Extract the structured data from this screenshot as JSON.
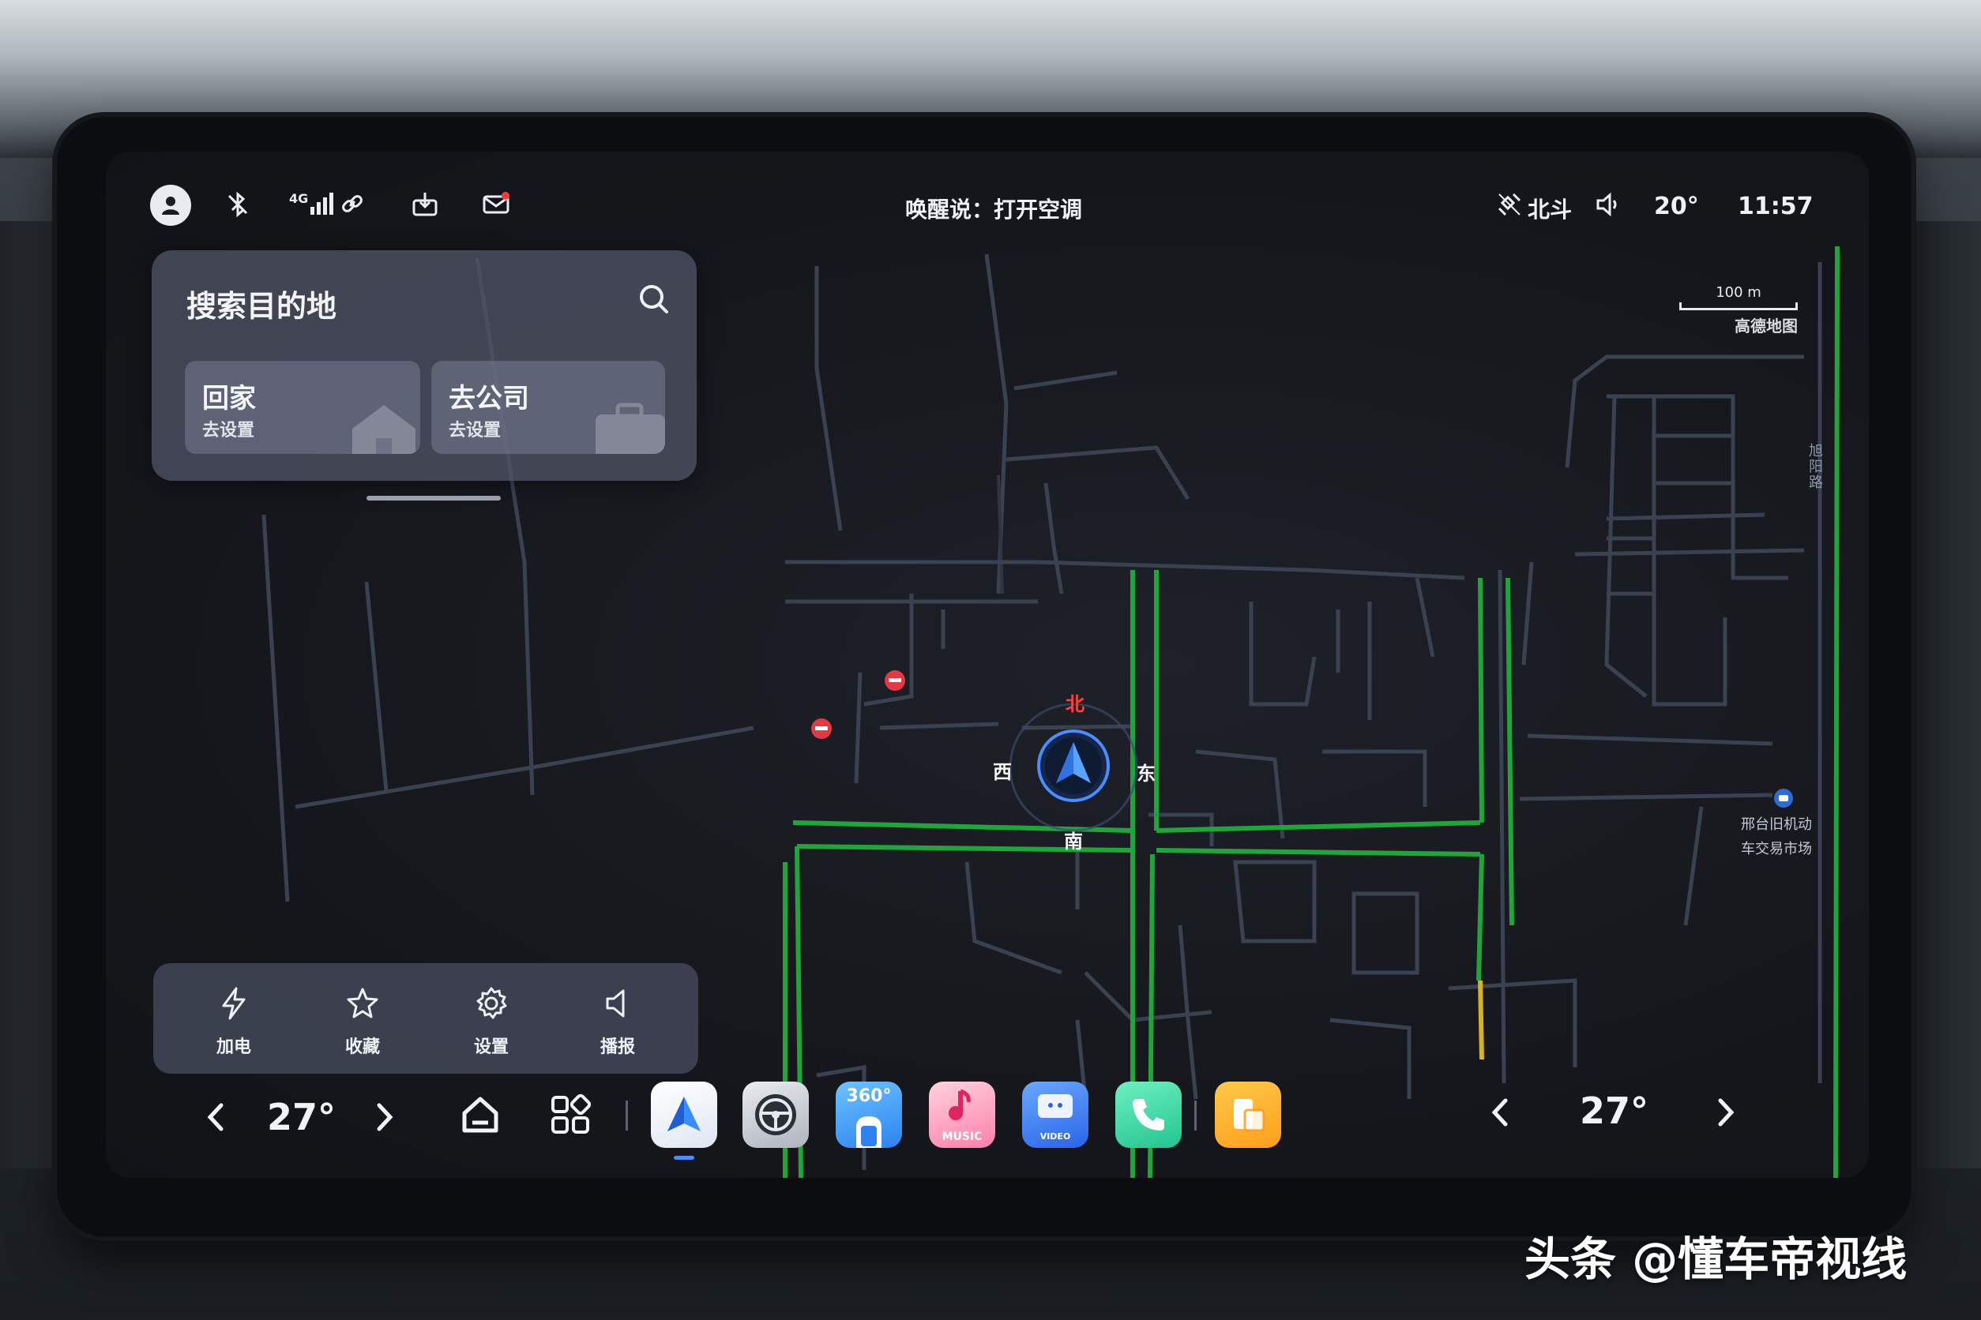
{
  "status_bar": {
    "network_label": "4G",
    "voice_hint": "唤醒说：打开空调",
    "gps_label": "北斗",
    "outside_temp": "20°",
    "time": "11:57"
  },
  "search": {
    "title": "搜索目的地",
    "home": {
      "label": "回家",
      "sub": "去设置"
    },
    "work": {
      "label": "去公司",
      "sub": "去设置"
    }
  },
  "quick_actions": [
    {
      "label": "加电",
      "icon": "lightning-icon"
    },
    {
      "label": "收藏",
      "icon": "star-icon"
    },
    {
      "label": "设置",
      "icon": "gear-icon"
    },
    {
      "label": "播报",
      "icon": "speaker-icon"
    }
  ],
  "map": {
    "scale": "100 m",
    "provider": "高德地图",
    "compass": {
      "north": "北",
      "south": "南",
      "east": "东",
      "west": "西"
    },
    "road_label": "旭阳路",
    "poi_line1": "邢台旧机动",
    "poi_line2": "车交易市场"
  },
  "dock": {
    "left_temp": "27°",
    "right_temp": "27°",
    "apps": [
      {
        "name": "navigation",
        "label": ""
      },
      {
        "name": "vehicle-settings",
        "label": ""
      },
      {
        "name": "camera-360",
        "label": "360°"
      },
      {
        "name": "music",
        "label": "MUSIC"
      },
      {
        "name": "video",
        "label": "VIDEO"
      },
      {
        "name": "phone",
        "label": ""
      },
      {
        "name": "screen-mirror",
        "label": ""
      }
    ]
  },
  "watermark": "头条 @懂车帝视线",
  "colors": {
    "accent": "#4a8dff",
    "route_green": "#1fa63a",
    "poi_red": "#e23a44"
  }
}
